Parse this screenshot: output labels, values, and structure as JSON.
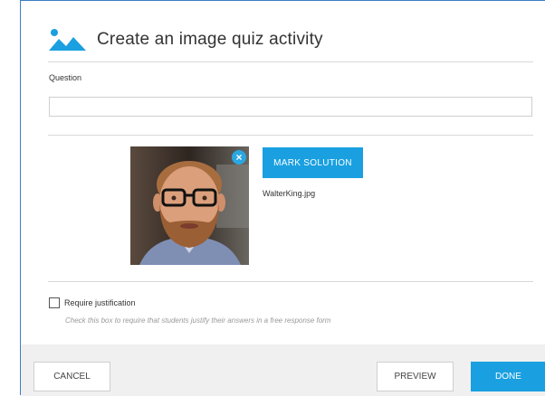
{
  "header": {
    "title": "Create an image quiz activity",
    "icon": "image-landscape-icon"
  },
  "question": {
    "label": "Question",
    "value": "",
    "placeholder": ""
  },
  "image_choice": {
    "filename": "WalterKing.jpg",
    "mark_solution_label": "MARK SOLUTION",
    "remove_icon": "close-icon",
    "remove_glyph": "×"
  },
  "justification": {
    "label": "Require justification",
    "help": "Check this box to require that students justify their answers in a free response form",
    "checked": false
  },
  "footer": {
    "cancel_label": "CANCEL",
    "preview_label": "PREVIEW",
    "done_label": "DONE"
  },
  "colors": {
    "accent": "#1aa0e0",
    "border": "#3b7fc4"
  }
}
